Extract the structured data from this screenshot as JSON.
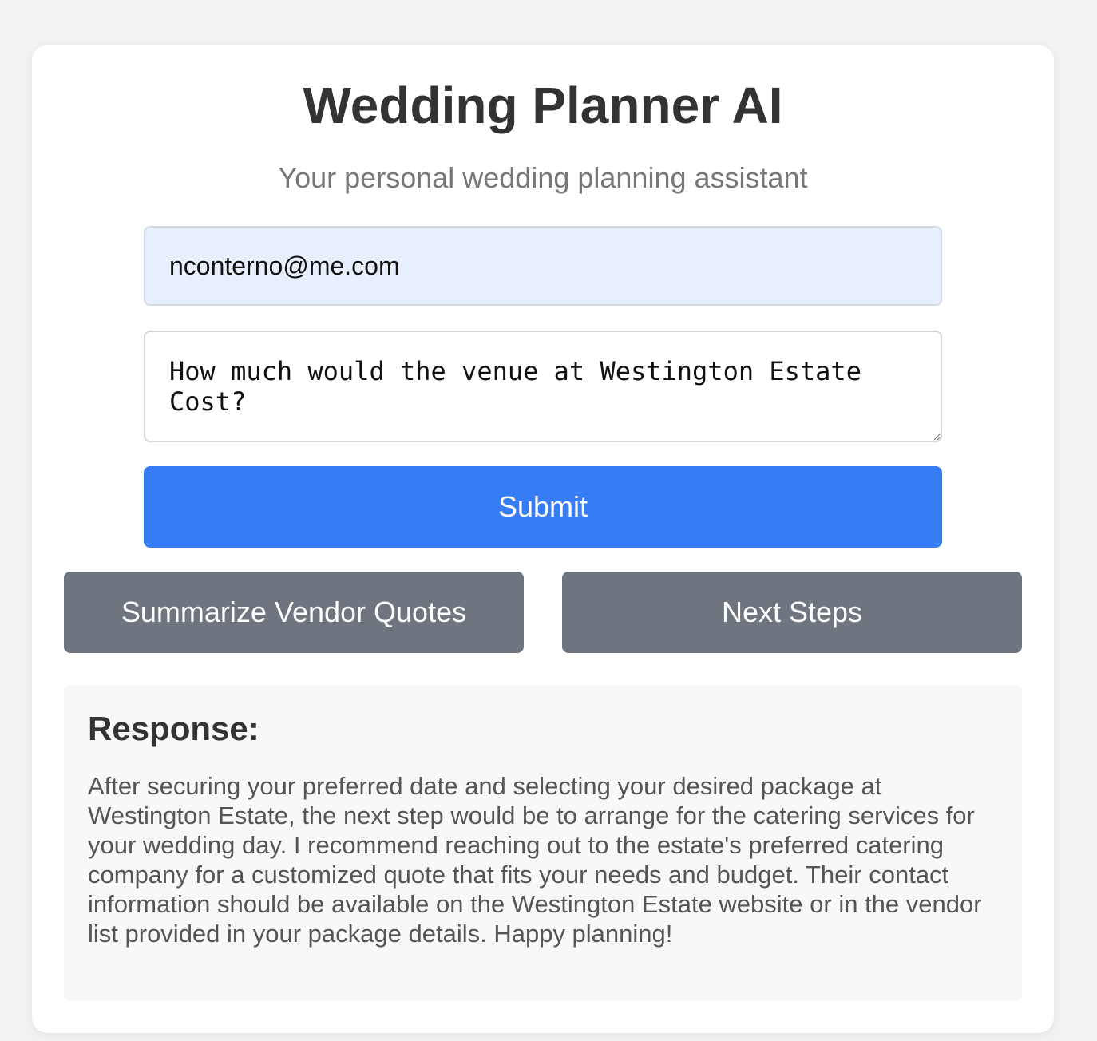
{
  "header": {
    "title": "Wedding Planner AI",
    "subtitle": "Your personal wedding planning assistant"
  },
  "form": {
    "email_value": "nconterno@me.com",
    "query_value": "How much would the venue at Westington Estate Cost?",
    "submit_label": "Submit"
  },
  "actions": {
    "summarize_label": "Summarize Vendor Quotes",
    "next_steps_label": "Next Steps"
  },
  "response": {
    "heading": "Response:",
    "text": "After securing your preferred date and selecting your desired package at Westington Estate, the next step would be to arrange for the catering services for your wedding day. I recommend reaching out to the estate's preferred catering company for a customized quote that fits your needs and budget. Their contact information should be available on the Westington Estate website or in the vendor list provided in your package details. Happy planning!"
  },
  "colors": {
    "primary": "#357cf5",
    "secondary": "#6f757e",
    "background": "#f2f2f2"
  }
}
